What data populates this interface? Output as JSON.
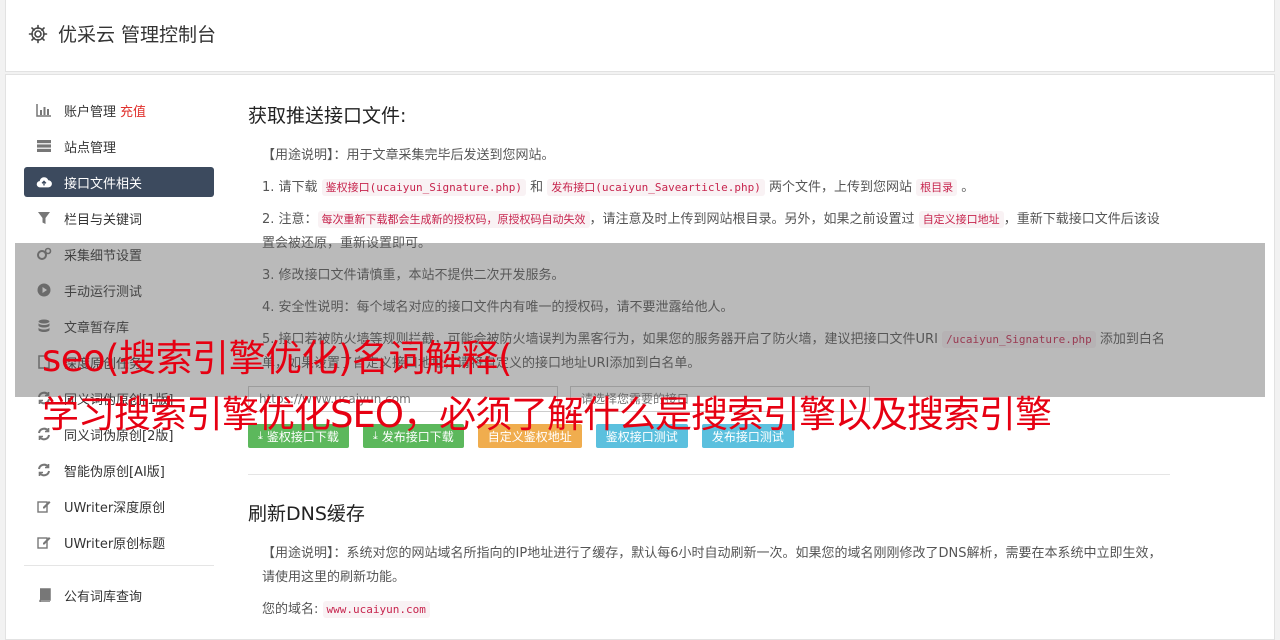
{
  "header": {
    "title": "优采云 管理控制台",
    "icon": "gear-icon"
  },
  "sidebar": {
    "items": [
      {
        "label": "账户管理",
        "extra": "充值",
        "icon": "bar-chart-icon"
      },
      {
        "label": "站点管理",
        "icon": "server-icon"
      },
      {
        "label": "接口文件相关",
        "icon": "cloud-upload-icon",
        "active": true
      },
      {
        "label": "栏目与关键词",
        "icon": "filter-icon"
      },
      {
        "label": "采集细节设置",
        "icon": "cogs-icon"
      },
      {
        "label": "手动运行测试",
        "icon": "play-icon"
      },
      {
        "label": "文章暂存库",
        "icon": "database-icon"
      },
      {
        "label": "深度原创任务",
        "icon": "file-icon"
      },
      {
        "label": "同义词伪原创[1版]",
        "icon": "refresh-icon"
      },
      {
        "label": "同义词伪原创[2版]",
        "icon": "refresh-icon"
      },
      {
        "label": "智能伪原创[AI版]",
        "icon": "refresh-icon"
      },
      {
        "label": "UWriter深度原创",
        "icon": "edit-icon"
      },
      {
        "label": "UWriter原创标题",
        "icon": "edit-icon"
      }
    ],
    "bottom_items": [
      {
        "label": "公有词库查询",
        "icon": "book-icon"
      }
    ]
  },
  "section1": {
    "title": "获取推送接口文件:",
    "usage_prefix": "【用途说明】：",
    "usage_text": "用于文章采集完毕后发送到您网站。",
    "item1": {
      "a": "1. 请下载 ",
      "code1": "鉴权接口(ucaiyun_Signature.php)",
      "b": " 和 ",
      "code2": "发布接口(ucaiyun_Savearticle.php)",
      "c": " 两个文件，上传到您网站 ",
      "code3": "根目录",
      "d": " 。"
    },
    "item2": {
      "a": "2. 注意：",
      "code1": "每次重新下载都会生成新的授权码，原授权码自动失效",
      "b": "，请注意及时上传到网站根目录。另外，如果之前设置过 ",
      "code2": "自定义接口地址",
      "c": "，重新下载接口文件后该设置会被还原，重新设置即可。"
    },
    "item3": "3. 修改接口文件请慎重，本站不提供二次开发服务。",
    "item4": "4. 安全性说明：每个域名对应的接口文件内有唯一的授权码，请不要泄露给他人。",
    "item5": {
      "a": "5. 接口若被防火墙等规则拦截，可能会被防火墙误判为黑客行为，如果您的服务器开启了防火墙，建议把接口文件URI ",
      "code1": "/ucaiyun_Signature.php",
      "b": " 添加到白名单，如果设置了自定义接口地址，请将自定义的接口地址URI添加到白名单。"
    },
    "url_placeholder": "https://www.ucaiyun.com",
    "select_placeholder": "请选择您需要的接口",
    "buttons": {
      "sig_download": "鉴权接口下载",
      "pub_download": "发布接口下载",
      "custom_url": "自定义鉴权地址",
      "sig_test": "鉴权接口测试",
      "pub_test": "发布接口测试"
    }
  },
  "section2": {
    "title": "刷新DNS缓存",
    "usage_prefix": "【用途说明】：",
    "usage_text": "系统对您的网站域名所指向的IP地址进行了缓存，默认每6小时自动刷新一次。如果您的域名刚刚修改了DNS解析，需要在本系统中立即生效，请使用这里的刷新功能。",
    "domain_label": "您的域名:",
    "domain_value": "www.ucaiyun.com"
  },
  "overlay": {
    "line1": "seo(搜索引擎优化)名词解释(",
    "line2": "学习搜索引擎优化SEO，必须了解什么是搜索引擎以及搜索引擎",
    "color": "#e60012"
  }
}
